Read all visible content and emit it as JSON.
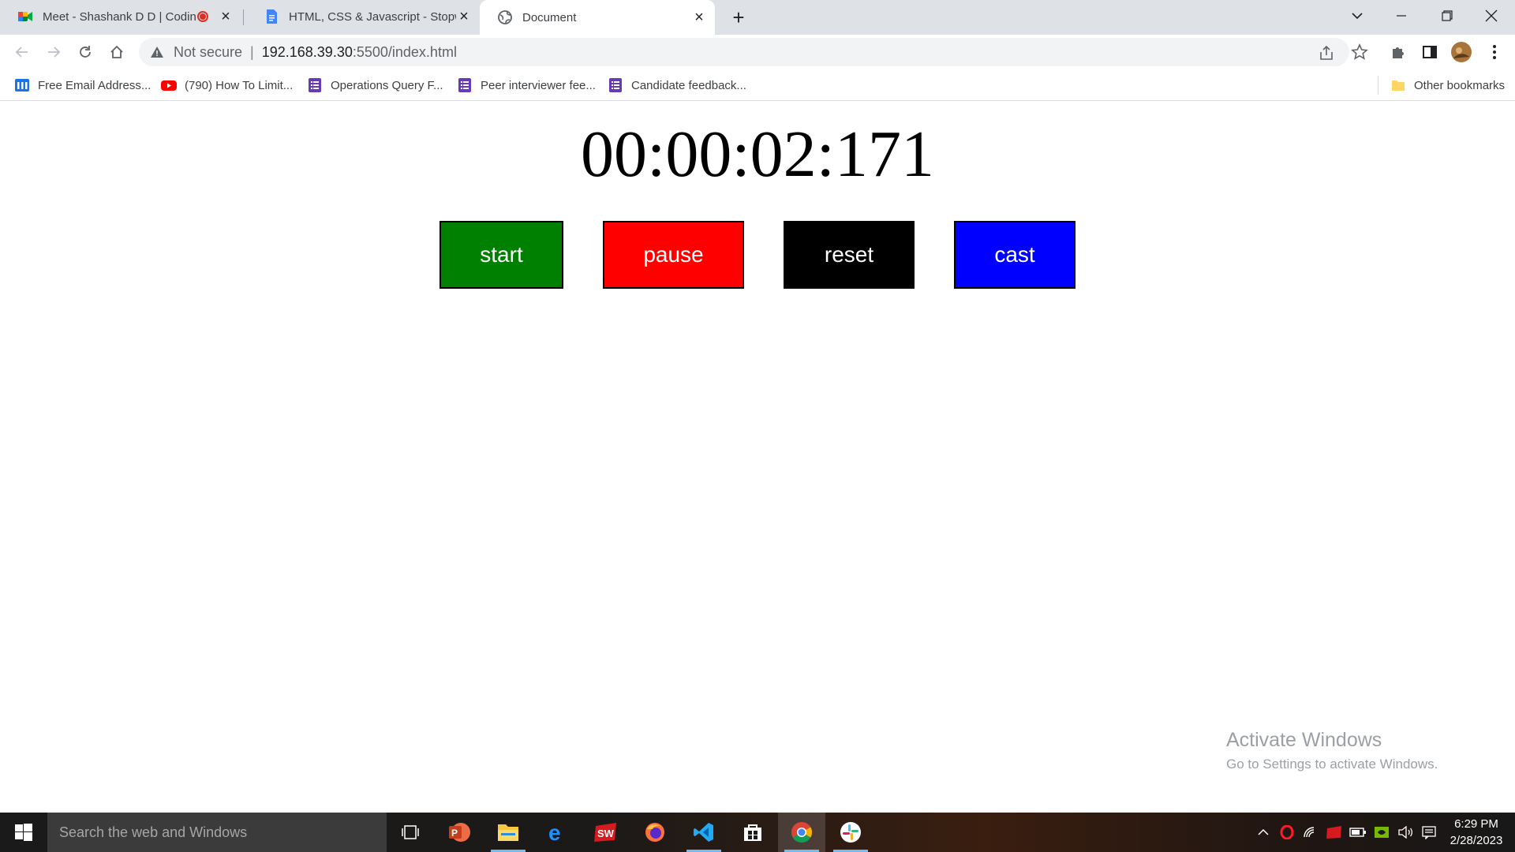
{
  "browser": {
    "tabs": [
      {
        "title": "Meet - Shashank D D | Codin",
        "icon": "google-meet-icon",
        "recording": true
      },
      {
        "title": "HTML, CSS & Javascript - Stopwa",
        "icon": "google-docs-icon"
      },
      {
        "title": "Document",
        "icon": "globe-icon",
        "active": true
      }
    ],
    "address": {
      "security_label": "Not secure",
      "host": "192.168.39.30",
      "path": ":5500/index.html"
    },
    "bookmarks": [
      {
        "label": "Free Email Address...",
        "icon": "mailinator-icon"
      },
      {
        "label": "(790) How To Limit...",
        "icon": "youtube-icon"
      },
      {
        "label": "Operations Query F...",
        "icon": "google-forms-icon"
      },
      {
        "label": "Peer interviewer fee...",
        "icon": "google-forms-icon"
      },
      {
        "label": "Candidate feedback...",
        "icon": "google-forms-icon"
      }
    ],
    "other_bookmarks": "Other bookmarks"
  },
  "stopwatch": {
    "time": "00:00:02:171",
    "buttons": {
      "start": "start",
      "pause": "pause",
      "reset": "reset",
      "cast": "cast"
    },
    "colors": {
      "start": "#008000",
      "pause": "#ff0000",
      "reset": "#000000",
      "cast": "#0000ff"
    }
  },
  "watermark": {
    "line1": "Activate Windows",
    "line2": "Go to Settings to activate Windows."
  },
  "taskbar": {
    "search_placeholder": "Search the web and Windows",
    "time": "6:29 PM",
    "date": "2/28/2023"
  }
}
